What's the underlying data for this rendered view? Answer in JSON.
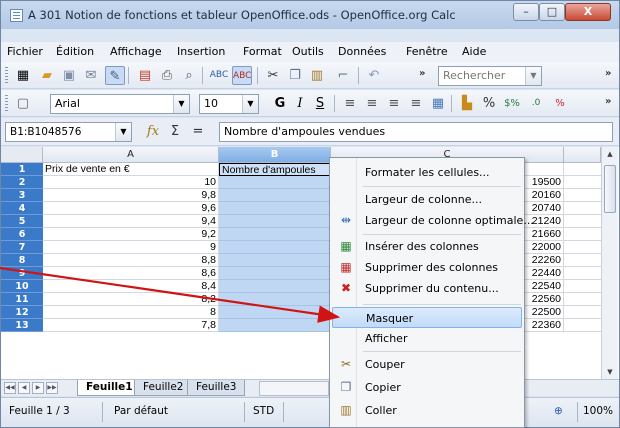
{
  "window": {
    "title": "A 301 Notion de fonctions et tableur OpenOffice.ods - OpenOffice.org Calc",
    "buttons": {
      "minimize": "–",
      "maximize": "□",
      "close": "X"
    }
  },
  "menubar": [
    "Fichier",
    "Édition",
    "Affichage",
    "Insertion",
    "Format",
    "Outils",
    "Données",
    "Fenêtre",
    "Aide"
  ],
  "toolbar1": {
    "search_placeholder": "Rechercher"
  },
  "toolbar2": {
    "font_name": "Arial",
    "font_size": "10",
    "bold": "G",
    "italic": "I",
    "underline": "S"
  },
  "formula": {
    "name_box": "B1:B1048576",
    "fx": "fx",
    "sigma": "Σ",
    "equals": "=",
    "value": "Nombre d'ampoules vendues"
  },
  "grid": {
    "columns": [
      "A",
      "B",
      "C"
    ],
    "rows": [
      "1",
      "2",
      "3",
      "4",
      "5",
      "6",
      "7",
      "8",
      "9",
      "10",
      "11",
      "12",
      "13"
    ],
    "colA": [
      "Prix de vente en €",
      "10",
      "9,8",
      "9,6",
      "9,4",
      "9,2",
      "9",
      "8,8",
      "8,6",
      "8,4",
      "8,2",
      "8",
      "7,8"
    ],
    "colB1": "Nombre d'ampoules",
    "colC": [
      "",
      "19500",
      "20160",
      "20740",
      "21240",
      "21660",
      "22000",
      "22260",
      "22440",
      "22540",
      "22560",
      "22500",
      "22360"
    ]
  },
  "sheets": [
    "Feuille1",
    "Feuille2",
    "Feuille3"
  ],
  "status": {
    "sheet": "Feuille 1 / 3",
    "style": "Par défaut",
    "mode": "STD",
    "zoom": "100%"
  },
  "context_menu": {
    "format_cells": "Formater les cellules...",
    "col_width": "Largeur de colonne...",
    "optimal_width": "Largeur de colonne optimale...",
    "insert_cols": "Insérer des colonnes",
    "delete_cols": "Supprimer des colonnes",
    "delete_contents": "Supprimer du contenu...",
    "hide": "Masquer",
    "show": "Afficher",
    "cut": "Couper",
    "copy": "Copier",
    "paste": "Coller"
  }
}
